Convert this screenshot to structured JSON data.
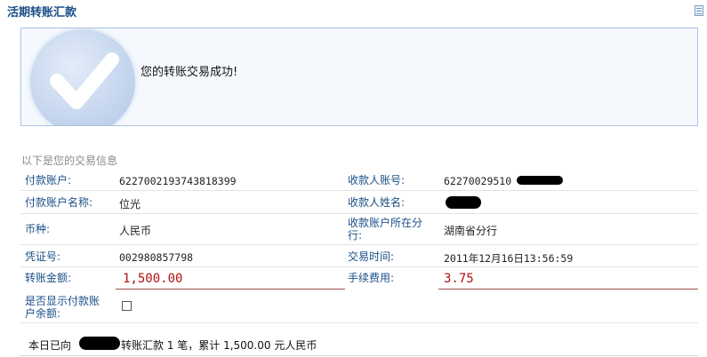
{
  "page": {
    "title": "活期转账汇款"
  },
  "success": {
    "message": "您的转账交易成功!"
  },
  "info": {
    "title": "以下是您的交易信息",
    "payer_account_label": "付款账户:",
    "payer_account_value": "6227002193743818399",
    "payee_account_label": "收款人账号:",
    "payee_account_value": "62270029510",
    "payer_name_label": "付款账户名称:",
    "payer_name_value": "位光",
    "payee_name_label": "收款人姓名:",
    "currency_label": "币种:",
    "currency_value": "人民币",
    "payee_branch_label_1": "收款账户所在分",
    "payee_branch_label_2": "行:",
    "payee_branch_value": "湖南省分行",
    "voucher_label": "凭证号:",
    "voucher_value": "002980857798",
    "trade_time_label": "交易时间:",
    "trade_time_value": "2011年12月16日13:56:59",
    "amount_label": "转账金额:",
    "amount_value": "1,500.00",
    "fee_label": "手续费用:",
    "fee_value": "3.75",
    "show_balance_label_1": "是否显示付款账",
    "show_balance_label_2": "户余额:",
    "show_balance_checked": false
  },
  "summary": {
    "prefix": "本日已向",
    "suffix": "转账汇款 1 笔，累计 1,500.00 元人民币"
  },
  "colors": {
    "label_blue": "#1a4f86",
    "amount_red": "#b01010",
    "box_border": "#a9c2e2"
  }
}
